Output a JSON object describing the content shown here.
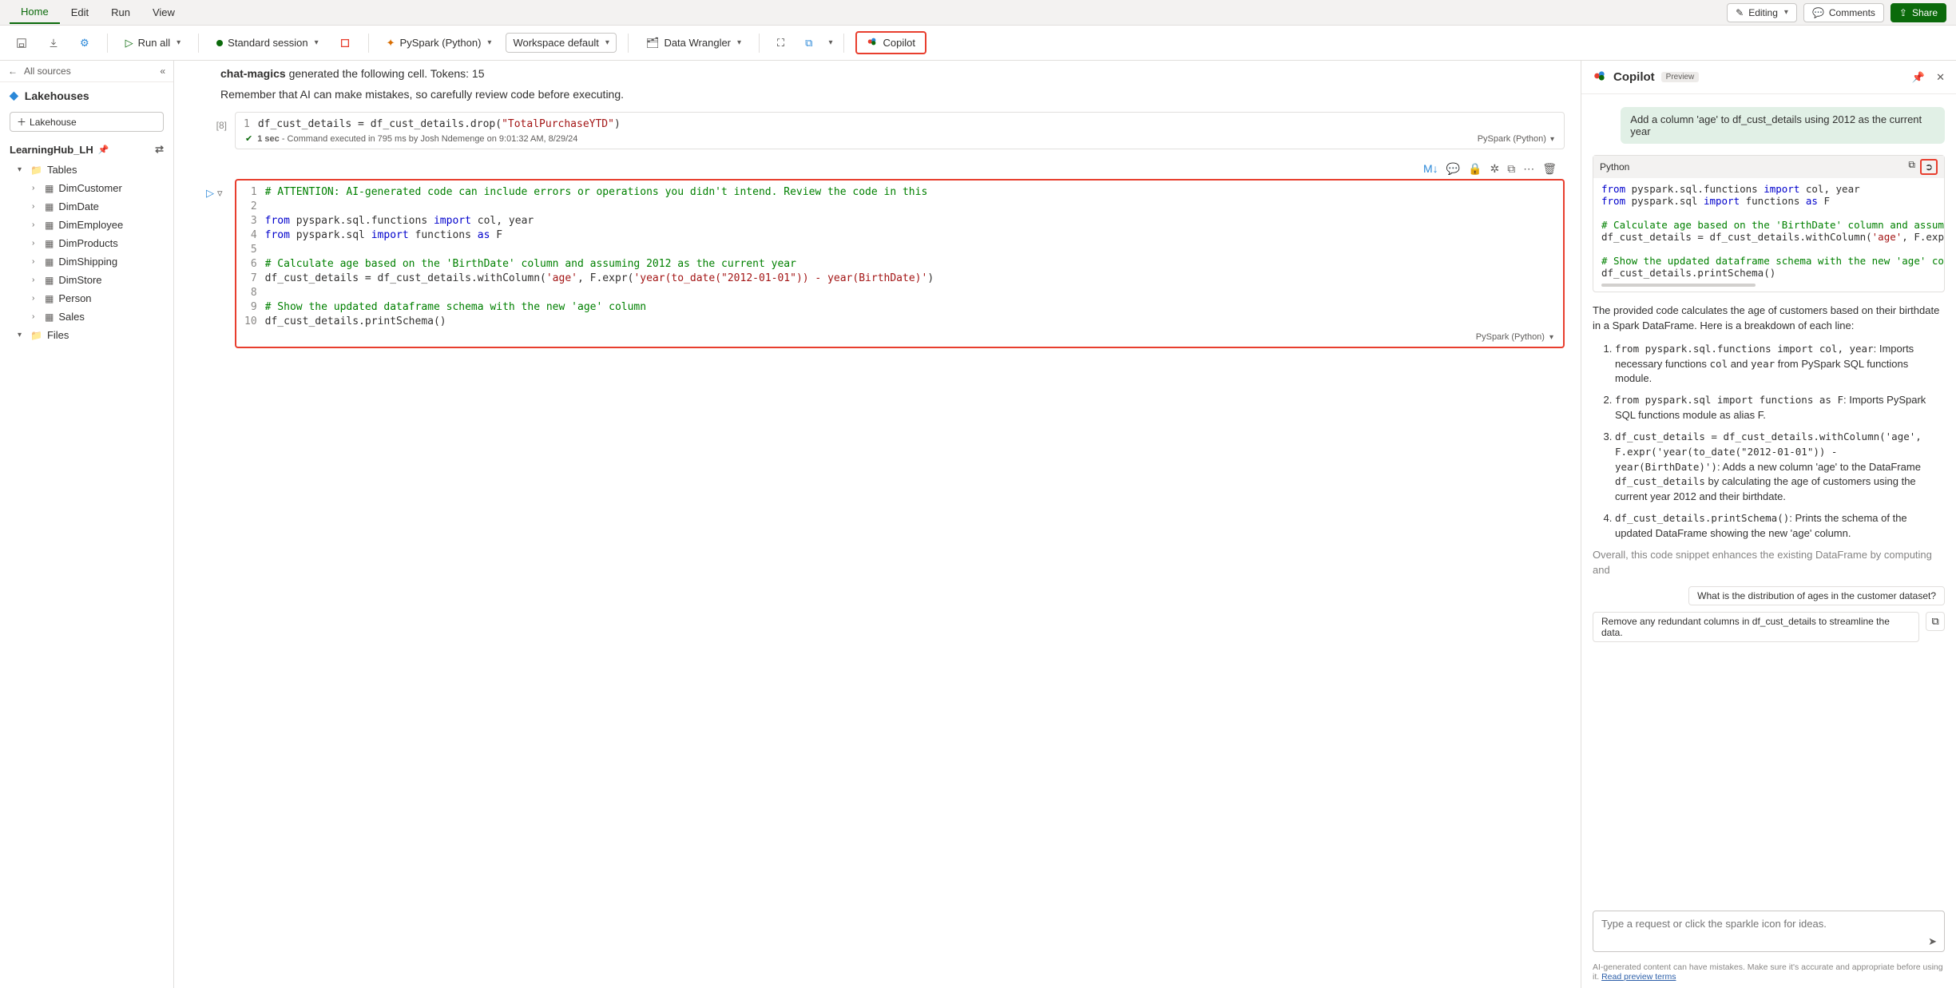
{
  "ribbon": {
    "tabs": [
      "Home",
      "Edit",
      "Run",
      "View"
    ],
    "editing": "Editing",
    "comments": "Comments",
    "share": "Share"
  },
  "toolbar": {
    "run_all": "Run all",
    "session": "Standard session",
    "language": "PySpark (Python)",
    "env": "Workspace default",
    "wrangler": "Data Wrangler",
    "copilot": "Copilot"
  },
  "sidebar": {
    "all_sources": "All sources",
    "lakehouses": "Lakehouses",
    "add_lakehouse": "Lakehouse",
    "lh_name": "LearningHub_LH",
    "tables_label": "Tables",
    "files_label": "Files",
    "tables": [
      "DimCustomer",
      "DimDate",
      "DimEmployee",
      "DimProducts",
      "DimShipping",
      "DimStore",
      "Person",
      "Sales"
    ]
  },
  "notebook": {
    "gen_prefix": "chat-magics",
    "gen_rest": " generated the following cell. Tokens: 15",
    "remember": "Remember that AI can make mistakes, so carefully review code before executing.",
    "cell1": {
      "exec_count": "[8]",
      "status": "1 sec - Command executed in 795 ms by Josh Ndemenge on 9:01:32 AM, 8/29/24",
      "lang": "PySpark (Python)",
      "lines": [
        {
          "n": "1",
          "html": "df_cust_details = df_cust_details.drop(<span class='str'>\"TotalPurchaseYTD\"</span>)"
        }
      ]
    },
    "cell2": {
      "lang": "PySpark (Python)",
      "lines": [
        {
          "n": "1",
          "html": "<span class='cmt'># ATTENTION: AI-generated code can include errors or operations you didn't intend. Review the code in this</span>"
        },
        {
          "n": "2",
          "html": ""
        },
        {
          "n": "3",
          "html": "<span class='kw'>from</span> pyspark.sql.functions <span class='kw'>import</span> col, year"
        },
        {
          "n": "4",
          "html": "<span class='kw'>from</span> pyspark.sql <span class='kw'>import</span> functions <span class='kw'>as</span> F"
        },
        {
          "n": "5",
          "html": ""
        },
        {
          "n": "6",
          "html": "<span class='cmt'># Calculate age based on the 'BirthDate' column and assuming 2012 as the current year</span>"
        },
        {
          "n": "7",
          "html": "df_cust_details = df_cust_details.withColumn(<span class='str'>'age'</span>, F.expr(<span class='str'>'year(to_date(\"2012-01-01\")) - year(BirthDate)'</span>)"
        },
        {
          "n": "8",
          "html": ""
        },
        {
          "n": "9",
          "html": "<span class='cmt'># Show the updated dataframe schema with the new 'age' column</span>"
        },
        {
          "n": "10",
          "html": "df_cust_details.printSchema()"
        }
      ]
    }
  },
  "copilot": {
    "title": "Copilot",
    "preview": "Preview",
    "user_msg": "Add a column 'age' to df_cust_details using 2012 as the current year",
    "code_lang": "Python",
    "code_lines": [
      "<span class='cp-kw'>from</span> pyspark.sql.functions <span class='cp-kw'>import</span> col, year",
      "<span class='cp-kw'>from</span> pyspark.sql <span class='cp-kw'>import</span> functions <span class='cp-kw'>as</span> F",
      "",
      "<span class='cp-cmt'># Calculate age based on the 'BirthDate' column and assuming</span>",
      "df_cust_details = df_cust_details.withColumn(<span class='cp-str'>'age'</span>, F.expr(",
      "",
      "<span class='cp-cmt'># Show the updated dataframe schema with the new 'age' colum</span>",
      "df_cust_details.printSchema()"
    ],
    "explain_intro": "The provided code calculates the age of customers based on their birthdate in a Spark DataFrame. Here is a breakdown of each line:",
    "bullets": [
      {
        "code": "from pyspark.sql.functions import col, year",
        "rest_before": ": Imports necessary functions ",
        "code2": "col",
        "mid": " and ",
        "code3": "year",
        "rest_after": " from PySpark SQL functions module."
      },
      {
        "code": "from pyspark.sql import functions as F",
        "rest_before": ": Imports PySpark SQL functions module as alias F.",
        "code2": "",
        "mid": "",
        "code3": "",
        "rest_after": ""
      },
      {
        "code": "df_cust_details = df_cust_details.withColumn('age', F.expr('year(to_date(\"2012-01-01\")) - year(BirthDate)')",
        "rest_before": ": Adds a new column 'age' to the DataFrame ",
        "code2": "df_cust_details",
        "mid": "",
        "code3": "",
        "rest_after": " by calculating the age of customers using the current year 2012 and their birthdate."
      },
      {
        "code": "df_cust_details.printSchema()",
        "rest_before": ": Prints the schema of the updated DataFrame showing the new 'age' column.",
        "code2": "",
        "mid": "",
        "code3": "",
        "rest_after": ""
      }
    ],
    "overall": "Overall, this code snippet enhances the existing DataFrame by computing and",
    "suggest1": "What is the distribution of ages in the customer dataset?",
    "suggest2": "Remove any redundant columns in df_cust_details to streamline the data.",
    "placeholder": "Type a request or click the sparkle icon for ideas.",
    "disclaimer": "AI-generated content can have mistakes. Make sure it's accurate and appropriate before using it. ",
    "disclaimer_link": "Read preview terms"
  }
}
